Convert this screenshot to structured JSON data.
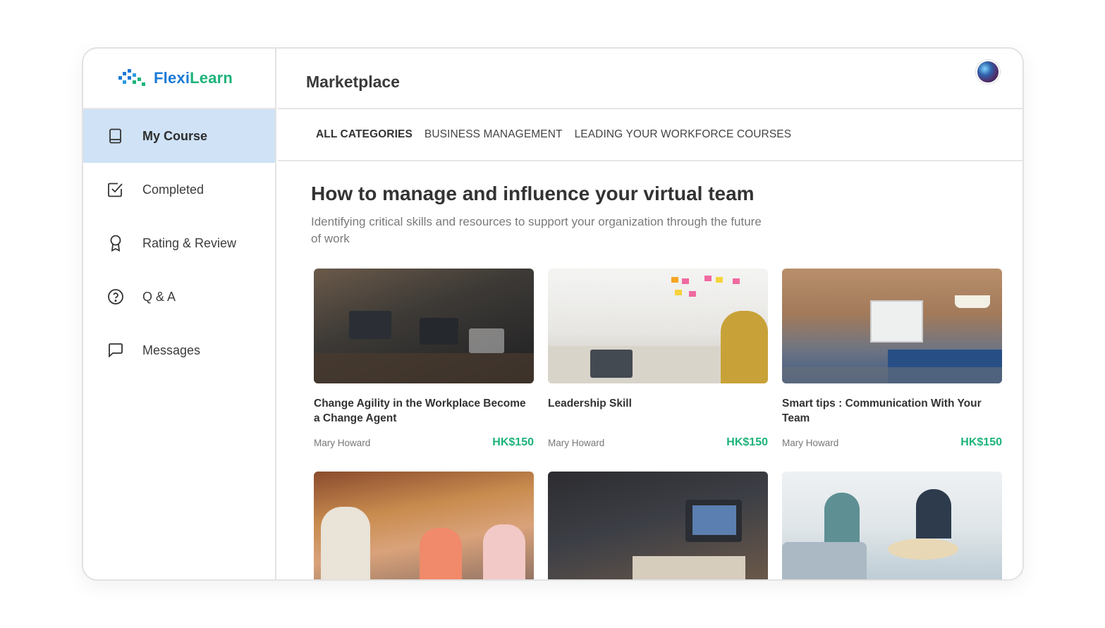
{
  "brand": {
    "name_part1": "Flexi",
    "name_part2": "Learn",
    "color_primary": "#1b79d6",
    "color_secondary": "#1db37a"
  },
  "sidebar": {
    "items": [
      {
        "label": "My Course",
        "icon": "book-icon",
        "active": true
      },
      {
        "label": "Completed",
        "icon": "checkbox-icon",
        "active": false
      },
      {
        "label": "Rating & Review",
        "icon": "award-ribbon-icon",
        "active": false
      },
      {
        "label": "Q & A",
        "icon": "question-circle-icon",
        "active": false
      },
      {
        "label": "Messages",
        "icon": "message-bubble-icon",
        "active": false
      }
    ]
  },
  "header": {
    "title": "Marketplace",
    "avatar_icon": "user-avatar"
  },
  "categories": [
    {
      "label": "ALL CATEGORIES",
      "active": true
    },
    {
      "label": "BUSINESS MANAGEMENT",
      "active": false
    },
    {
      "label": "LEADING YOUR WORKFORCE COURSES",
      "active": false
    }
  ],
  "section": {
    "title": "How to manage and influence your virtual team",
    "subtitle": "Identifying critical skills and resources to support your organization through the future of work"
  },
  "courses": [
    {
      "title": "Change Agility in the Workplace Become a Change Agent",
      "author": "Mary Howard",
      "price": "HK$150"
    },
    {
      "title": "Leadership Skill",
      "author": "Mary Howard",
      "price": "HK$150"
    },
    {
      "title": "Smart tips : Communication With Your Team",
      "author": "Mary Howard",
      "price": "HK$150"
    },
    {
      "title": "",
      "author": "",
      "price": ""
    },
    {
      "title": "",
      "author": "",
      "price": ""
    },
    {
      "title": "",
      "author": "",
      "price": ""
    }
  ],
  "colors": {
    "active_nav_bg": "#cfe2f6",
    "price_green": "#1db37a"
  }
}
